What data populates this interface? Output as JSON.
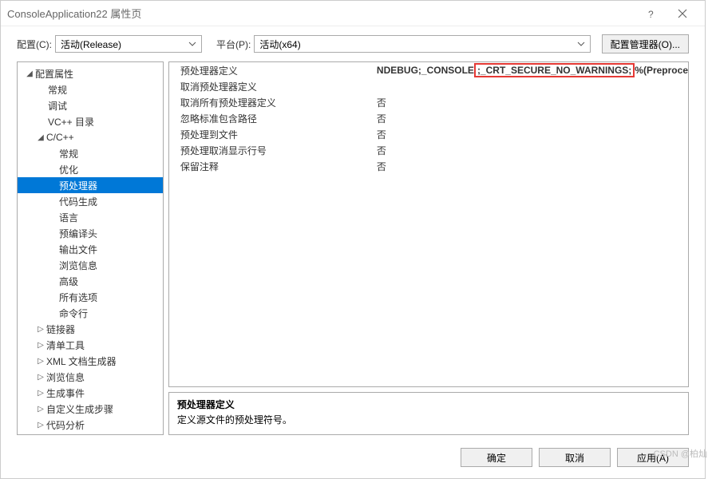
{
  "window": {
    "title": "ConsoleApplication22 属性页"
  },
  "toolbar": {
    "config_label": "配置(C):",
    "config_value": "活动(Release)",
    "platform_label": "平台(P):",
    "platform_value": "活动(x64)",
    "config_manager": "配置管理器(O)..."
  },
  "tree": {
    "root": "配置属性",
    "general": "常规",
    "debug": "调试",
    "vcdirs": "VC++ 目录",
    "ccpp": "C/C++",
    "ccpp_general": "常规",
    "ccpp_optimize": "优化",
    "ccpp_preproc": "预处理器",
    "ccpp_codegen": "代码生成",
    "ccpp_lang": "语言",
    "ccpp_pch": "预编译头",
    "ccpp_output": "输出文件",
    "ccpp_browse": "浏览信息",
    "ccpp_advanced": "高级",
    "ccpp_all": "所有选项",
    "ccpp_cmd": "命令行",
    "linker": "链接器",
    "manifest": "清单工具",
    "xmldoc": "XML 文档生成器",
    "browseinfo": "浏览信息",
    "buildevt": "生成事件",
    "custombuild": "自定义生成步骤",
    "codeanalysis": "代码分析"
  },
  "grid": {
    "r0": {
      "label": "预处理器定义",
      "value_pre": "NDEBUG;_CONSOLE",
      "value_hl": ";_CRT_SECURE_NO_WARNINGS;",
      "value_post": "%(Preproce"
    },
    "r1": {
      "label": "取消预处理器定义",
      "value": ""
    },
    "r2": {
      "label": "取消所有预处理器定义",
      "value": "否"
    },
    "r3": {
      "label": "忽略标准包含路径",
      "value": "否"
    },
    "r4": {
      "label": "预处理到文件",
      "value": "否"
    },
    "r5": {
      "label": "预处理取消显示行号",
      "value": "否"
    },
    "r6": {
      "label": "保留注释",
      "value": "否"
    }
  },
  "desc": {
    "title": "预处理器定义",
    "body": "定义源文件的预处理符号。"
  },
  "footer": {
    "ok": "确定",
    "cancel": "取消",
    "apply": "应用(A)"
  },
  "watermark": "CSDN @柏灿"
}
